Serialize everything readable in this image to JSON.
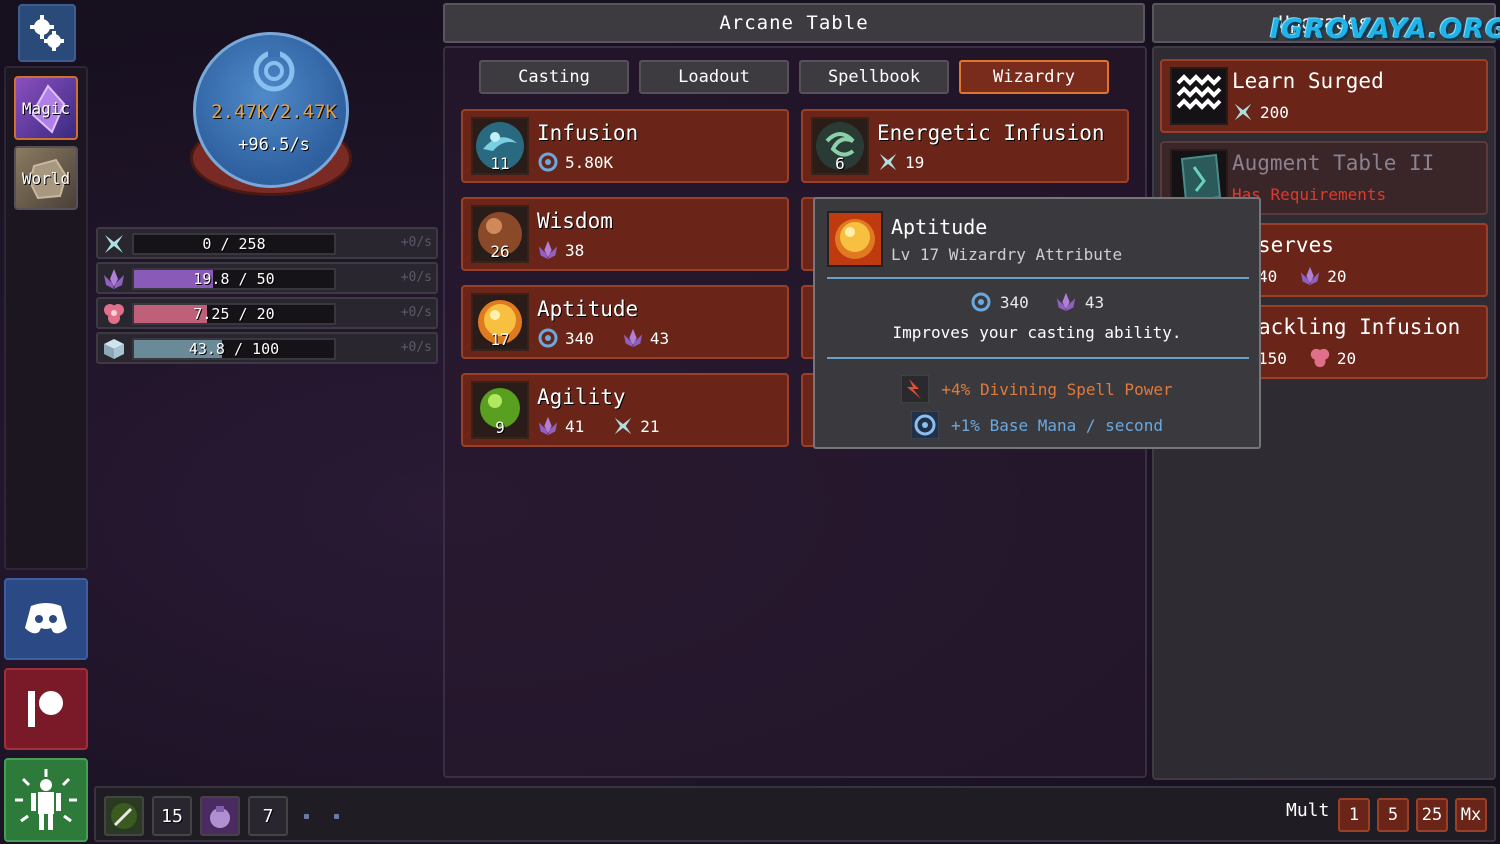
{
  "sidebar": {
    "magic_label": "Magic",
    "world_label": "World"
  },
  "mana": {
    "amount": "2.47K/2.47K",
    "rate": "+96.5/s"
  },
  "resources": [
    {
      "icon": "lightning-rune-icon",
      "text": "0 / 258",
      "rate": "+0/s",
      "fill": 0,
      "color": "#3a3a3a"
    },
    {
      "icon": "lotus-icon",
      "text": "19.8 / 50",
      "rate": "+0/s",
      "fill": 0.396,
      "color": "#8a5ab8"
    },
    {
      "icon": "heart-flower-icon",
      "text": "7.25 / 20",
      "rate": "+0/s",
      "fill": 0.3625,
      "color": "#c06078"
    },
    {
      "icon": "cube-icon",
      "text": "43.8 / 100",
      "rate": "+0/s",
      "fill": 0.438,
      "color": "#6a8a98"
    }
  ],
  "main": {
    "title": "Arcane Table",
    "tabs": [
      "Casting",
      "Loadout",
      "Spellbook",
      "Wizardry"
    ],
    "cards": [
      {
        "name": "Infusion",
        "level": "11",
        "cost1": "5.80K"
      },
      {
        "name": "Energetic Infusion",
        "level": "6",
        "cost1": "19"
      },
      {
        "name": "Wisdom",
        "level": "26",
        "cost1": "38"
      },
      {
        "name": "Aptitude",
        "level": "17",
        "cost1": "340",
        "cost2": "43"
      },
      {
        "name": "Agility",
        "level": "9",
        "cost1": "41",
        "cost2": "21"
      }
    ]
  },
  "tooltip": {
    "name": "Aptitude",
    "subtitle": "Lv 17 Wizardry Attribute",
    "cost_mana": "340",
    "cost_lotus": "43",
    "description": "Improves your casting ability.",
    "bonus1": "+4% Divining Spell Power",
    "bonus2": "+1% Base Mana / second"
  },
  "upgrades": {
    "title": "Upgrades",
    "items": [
      {
        "name": "Learn Surged",
        "cost1": "200"
      },
      {
        "name": "Augment Table II",
        "requirement": "Has Requirements"
      },
      {
        "name": "serves",
        "cost1": "40",
        "cost2": "20"
      },
      {
        "name": "ackling Infusion",
        "cost1": "150",
        "cost2": "20"
      }
    ]
  },
  "watermark": "IGROVAYA.ORG",
  "bottom": {
    "slots": [
      "15",
      "7"
    ],
    "mult_label": "Mult",
    "mult_options": [
      "1",
      "5",
      "25",
      "Mx"
    ]
  },
  "colors": {
    "accent": "#e0742c",
    "card": "#6a2518",
    "mana": "#4f8ac8",
    "bonus_orange": "#e07a3a",
    "bonus_blue": "#6aa8e0"
  }
}
